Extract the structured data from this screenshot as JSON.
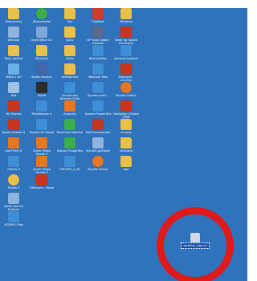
{
  "colors": {
    "desktop_bg": "#2f73bd",
    "ring": "#e0191b",
    "selection_bg": "#1c4fa8"
  },
  "desktop_icons": [
    {
      "label": "Dokumenty",
      "icon": "folder-icon",
      "color": "#e9c04a",
      "row": 0,
      "col": 0
    },
    {
      "label": "JDownloader",
      "icon": "jdownloader-icon",
      "color": "#3cae4b",
      "row": 0,
      "col": 1
    },
    {
      "label": "Kid",
      "icon": "folder-icon",
      "color": "#e9c04a",
      "row": 0,
      "col": 2
    },
    {
      "label": "FlipMast",
      "icon": "flipmast-icon",
      "color": "#d43a2a",
      "row": 0,
      "col": 3
    },
    {
      "label": "Windows",
      "icon": "windows-icon",
      "color": "#e9c04a",
      "row": 0,
      "col": 4
    },
    {
      "label": "Wiimote",
      "icon": "computer-icon",
      "color": "#8fb3e0",
      "row": 1,
      "col": 0
    },
    {
      "label": "OpenOffice 3.0",
      "icon": "openoffice-icon",
      "color": "#7fa8d8",
      "row": 1,
      "col": 1
    },
    {
      "label": "Jacky",
      "icon": "folder-icon",
      "color": "#e9c04a",
      "row": 1,
      "col": 2
    },
    {
      "label": "HP Scan Adobe Capture",
      "icon": "scanner-icon",
      "color": "#5a6a8a",
      "row": 1,
      "col": 3
    },
    {
      "label": "Need for Speed Pro Street",
      "icon": "nfs-icon",
      "color": "#c9361f",
      "row": 1,
      "col": 4
    },
    {
      "label": "Texty počítač",
      "icon": "folder-icon",
      "color": "#e9c04a",
      "row": 2,
      "col": 0
    },
    {
      "label": "Stanislav",
      "icon": "folder-icon",
      "color": "#e9c04a",
      "row": 2,
      "col": 1
    },
    {
      "label": "Video",
      "icon": "folder-icon",
      "color": "#e9c04a",
      "row": 2,
      "col": 2
    },
    {
      "label": "NetCashMen",
      "icon": "network-icon",
      "color": "#3f8fd8",
      "row": 2,
      "col": 3
    },
    {
      "label": "Internet Explorer",
      "icon": "internet-explorer-icon",
      "color": "#3f8fd8",
      "row": 2,
      "col": 4
    },
    {
      "label": "Místa v síti",
      "icon": "network-places-icon",
      "color": "#6ab0e8",
      "row": 3,
      "col": 0
    },
    {
      "label": "Studio Version",
      "icon": "studio-icon",
      "color": "#4466aa",
      "row": 3,
      "col": 1
    },
    {
      "label": "webkamera",
      "icon": "folder-icon",
      "color": "#e9c04a",
      "row": 3,
      "col": 2
    },
    {
      "label": "Webcam Max",
      "icon": "webcam-icon",
      "color": "#3f8fd8",
      "row": 3,
      "col": 3
    },
    {
      "label": "Zástupce - novinky",
      "icon": "shortcut-icon",
      "color": "#c9361f",
      "row": 3,
      "col": 4
    },
    {
      "label": "Koš",
      "icon": "recycle-bin-icon",
      "color": "#9cc2e6",
      "row": 4,
      "col": 0
    },
    {
      "label": "Tablet",
      "icon": "tablet-icon",
      "color": "#2b2b2b",
      "row": 4,
      "col": 1
    },
    {
      "label": "Access bez Director Suite",
      "icon": "access-icon",
      "color": "#3f8fd8",
      "row": 4,
      "col": 2
    },
    {
      "label": "Spustit profil...",
      "icon": "profile-icon",
      "color": "#3f8fd8",
      "row": 4,
      "col": 3
    },
    {
      "label": "Mozilla Firefox",
      "icon": "firefox-icon",
      "color": "#e87722",
      "row": 4,
      "col": 4
    },
    {
      "label": "My Phones",
      "icon": "phone-icon",
      "color": "#c9361f",
      "row": 5,
      "col": 0
    },
    {
      "label": "PeerWeaver 4",
      "icon": "peerweaver-icon",
      "color": "#3f8fd8",
      "row": 5,
      "col": 1
    },
    {
      "label": "Audacity",
      "icon": "audacity-icon",
      "color": "#e87722",
      "row": 5,
      "col": 2
    },
    {
      "label": "System Properties",
      "icon": "system-icon",
      "color": "#3f8fd8",
      "row": 5,
      "col": 3
    },
    {
      "label": "Navigátor ČEskou 2008",
      "icon": "pc-icon",
      "color": "#c9361f",
      "row": 5,
      "col": 4
    },
    {
      "label": "Adobe Reader 8",
      "icon": "adobe-reader-icon",
      "color": "#c9361f",
      "row": 6,
      "col": 0
    },
    {
      "label": "Mozilla SR Skype",
      "icon": "skype-icon",
      "color": "#3f8fd8",
      "row": 6,
      "col": 1
    },
    {
      "label": "Bookmark Monitor",
      "icon": "bookmark-icon",
      "color": "#3cae4b",
      "row": 6,
      "col": 2
    },
    {
      "label": "Total Commander",
      "icon": "total-commander-icon",
      "color": "#c9361f",
      "row": 6,
      "col": 3
    },
    {
      "label": "scruboy",
      "icon": "folder-icon",
      "color": "#e9c04a",
      "row": 6,
      "col": 4
    },
    {
      "label": "eXeTPrint 0",
      "icon": "print-icon",
      "color": "#e87722",
      "row": 7,
      "col": 0
    },
    {
      "label": "Zoner Photo Studio 9",
      "icon": "zoner-photo-icon",
      "color": "#e87722",
      "row": 7,
      "col": 1
    },
    {
      "label": "Display Properties",
      "icon": "display-icon",
      "color": "#3cae4b",
      "row": 7,
      "col": 2
    },
    {
      "label": "Vytvořit počítače",
      "icon": "computer-icon",
      "color": "#8fb3e0",
      "row": 7,
      "col": 3
    },
    {
      "label": "Instalace",
      "icon": "folder-icon",
      "color": "#e9c04a",
      "row": 7,
      "col": 4
    },
    {
      "label": "eXeLIS 0",
      "icon": "app-icon",
      "color": "#3f8fd8",
      "row": 8,
      "col": 0
    },
    {
      "label": "Zoner Photo Studio 9",
      "icon": "zoner-photo-icon",
      "color": "#e87722",
      "row": 8,
      "col": 1
    },
    {
      "label": "PDFZIPS_2_04",
      "icon": "pdf-zip-icon",
      "color": "#3f8fd8",
      "row": 8,
      "col": 2
    },
    {
      "label": "Mozilla Firefox",
      "icon": "firefox-icon",
      "color": "#e87722",
      "row": 8,
      "col": 3
    },
    {
      "label": "zábr",
      "icon": "folder-icon",
      "color": "#e9c04a",
      "row": 8,
      "col": 4
    },
    {
      "label": "Picasa 3",
      "icon": "picasa-icon",
      "color": "#e9c04a",
      "row": 9,
      "col": 0
    },
    {
      "label": "Zástupce - Noise",
      "icon": "shortcut-icon",
      "color": "#c9361f",
      "row": 9,
      "col": 1
    },
    {
      "label": "Quad Launch Buttons",
      "icon": "launcher-icon",
      "color": "#8fb3e0",
      "row": 10,
      "col": 0
    },
    {
      "label": "ACDVRL Files",
      "icon": "acd-icon",
      "color": "#3f8fd8",
      "row": 11,
      "col": 0
    }
  ],
  "selected_icon": {
    "label": "weather_sign.ini",
    "icon": "file-icon"
  }
}
